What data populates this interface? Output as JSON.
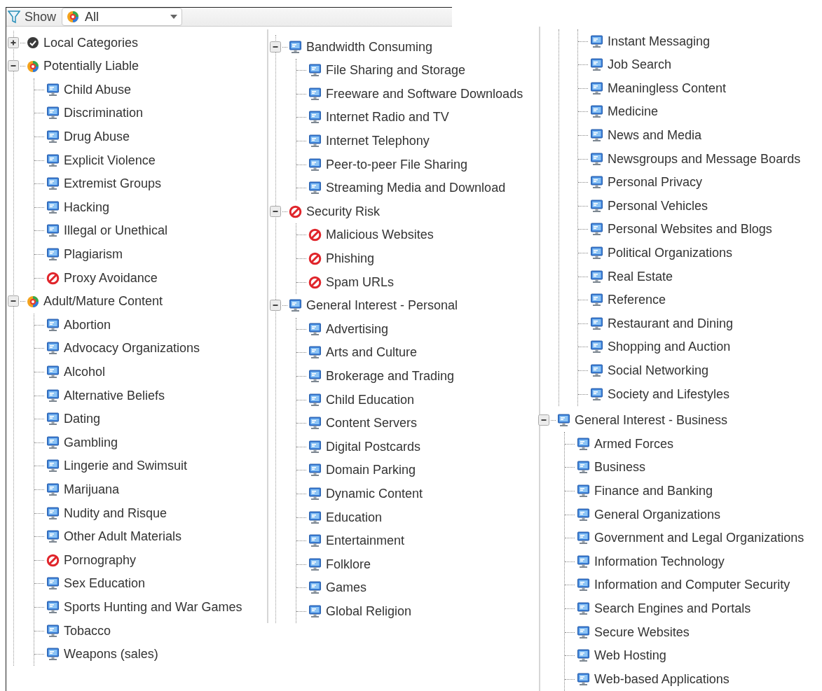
{
  "toolbar": {
    "label": "Show",
    "filter": {
      "value": "All",
      "kind": "mixed"
    }
  },
  "columns": [
    {
      "nodes": [
        {
          "label": "Local Categories",
          "kind": "allowed",
          "expanded": false
        },
        {
          "label": "Potentially Liable",
          "kind": "mixed",
          "expanded": true,
          "children": [
            {
              "label": "Child Abuse",
              "kind": "monitor"
            },
            {
              "label": "Discrimination",
              "kind": "monitor"
            },
            {
              "label": "Drug Abuse",
              "kind": "monitor"
            },
            {
              "label": "Explicit Violence",
              "kind": "monitor"
            },
            {
              "label": "Extremist Groups",
              "kind": "monitor"
            },
            {
              "label": "Hacking",
              "kind": "monitor"
            },
            {
              "label": "Illegal or Unethical",
              "kind": "monitor"
            },
            {
              "label": "Plagiarism",
              "kind": "monitor"
            },
            {
              "label": "Proxy Avoidance",
              "kind": "blocked"
            }
          ]
        },
        {
          "label": "Adult/Mature Content",
          "kind": "mixed",
          "expanded": true,
          "children": [
            {
              "label": "Abortion",
              "kind": "monitor"
            },
            {
              "label": "Advocacy Organizations",
              "kind": "monitor"
            },
            {
              "label": "Alcohol",
              "kind": "monitor"
            },
            {
              "label": "Alternative Beliefs",
              "kind": "monitor"
            },
            {
              "label": "Dating",
              "kind": "monitor"
            },
            {
              "label": "Gambling",
              "kind": "monitor"
            },
            {
              "label": "Lingerie and Swimsuit",
              "kind": "monitor"
            },
            {
              "label": "Marijuana",
              "kind": "monitor"
            },
            {
              "label": "Nudity and Risque",
              "kind": "monitor"
            },
            {
              "label": "Other Adult Materials",
              "kind": "monitor"
            },
            {
              "label": "Pornography",
              "kind": "blocked"
            },
            {
              "label": "Sex Education",
              "kind": "monitor"
            },
            {
              "label": "Sports Hunting and War Games",
              "kind": "monitor"
            },
            {
              "label": "Tobacco",
              "kind": "monitor"
            },
            {
              "label": "Weapons (sales)",
              "kind": "monitor"
            }
          ]
        }
      ]
    },
    {
      "nodes": [
        {
          "label": "Bandwidth Consuming",
          "kind": "monitor",
          "expanded": true,
          "children": [
            {
              "label": "File Sharing and Storage",
              "kind": "monitor"
            },
            {
              "label": "Freeware and Software Downloads",
              "kind": "monitor"
            },
            {
              "label": "Internet Radio and TV",
              "kind": "monitor"
            },
            {
              "label": "Internet Telephony",
              "kind": "monitor"
            },
            {
              "label": "Peer-to-peer File Sharing",
              "kind": "monitor"
            },
            {
              "label": "Streaming Media and Download",
              "kind": "monitor"
            }
          ]
        },
        {
          "label": "Security Risk",
          "kind": "blocked",
          "expanded": true,
          "children": [
            {
              "label": "Malicious Websites",
              "kind": "blocked"
            },
            {
              "label": "Phishing",
              "kind": "blocked"
            },
            {
              "label": "Spam URLs",
              "kind": "blocked"
            }
          ]
        },
        {
          "label": "General Interest - Personal",
          "kind": "monitor",
          "expanded": true,
          "children": [
            {
              "label": "Advertising",
              "kind": "monitor"
            },
            {
              "label": "Arts and Culture",
              "kind": "monitor"
            },
            {
              "label": "Brokerage and Trading",
              "kind": "monitor"
            },
            {
              "label": "Child Education",
              "kind": "monitor"
            },
            {
              "label": "Content Servers",
              "kind": "monitor"
            },
            {
              "label": "Digital Postcards",
              "kind": "monitor"
            },
            {
              "label": "Domain Parking",
              "kind": "monitor"
            },
            {
              "label": "Dynamic Content",
              "kind": "monitor"
            },
            {
              "label": "Education",
              "kind": "monitor"
            },
            {
              "label": "Entertainment",
              "kind": "monitor"
            },
            {
              "label": "Folklore",
              "kind": "monitor"
            },
            {
              "label": "Games",
              "kind": "monitor"
            },
            {
              "label": "Global Religion",
              "kind": "monitor"
            }
          ]
        }
      ]
    },
    {
      "continued": [
        {
          "label": "Instant Messaging",
          "kind": "monitor"
        },
        {
          "label": "Job Search",
          "kind": "monitor"
        },
        {
          "label": "Meaningless Content",
          "kind": "monitor"
        },
        {
          "label": "Medicine",
          "kind": "monitor"
        },
        {
          "label": "News and Media",
          "kind": "monitor"
        },
        {
          "label": "Newsgroups and Message Boards",
          "kind": "monitor"
        },
        {
          "label": "Personal Privacy",
          "kind": "monitor"
        },
        {
          "label": "Personal Vehicles",
          "kind": "monitor"
        },
        {
          "label": "Personal Websites and Blogs",
          "kind": "monitor"
        },
        {
          "label": "Political Organizations",
          "kind": "monitor"
        },
        {
          "label": "Real Estate",
          "kind": "monitor"
        },
        {
          "label": "Reference",
          "kind": "monitor"
        },
        {
          "label": "Restaurant and Dining",
          "kind": "monitor"
        },
        {
          "label": "Shopping and Auction",
          "kind": "monitor"
        },
        {
          "label": "Social Networking",
          "kind": "monitor"
        },
        {
          "label": "Society and Lifestyles",
          "kind": "monitor"
        }
      ],
      "nodes": [
        {
          "label": "General Interest - Business",
          "kind": "monitor",
          "expanded": true,
          "children": [
            {
              "label": "Armed Forces",
              "kind": "monitor"
            },
            {
              "label": "Business",
              "kind": "monitor"
            },
            {
              "label": "Finance and Banking",
              "kind": "monitor"
            },
            {
              "label": "General Organizations",
              "kind": "monitor"
            },
            {
              "label": "Government and Legal Organizations",
              "kind": "monitor"
            },
            {
              "label": "Information Technology",
              "kind": "monitor"
            },
            {
              "label": "Information and Computer Security",
              "kind": "monitor"
            },
            {
              "label": "Search Engines and Portals",
              "kind": "monitor"
            },
            {
              "label": "Secure Websites",
              "kind": "monitor"
            },
            {
              "label": "Web Hosting",
              "kind": "monitor"
            },
            {
              "label": "Web-based Applications",
              "kind": "monitor"
            }
          ]
        }
      ]
    }
  ]
}
